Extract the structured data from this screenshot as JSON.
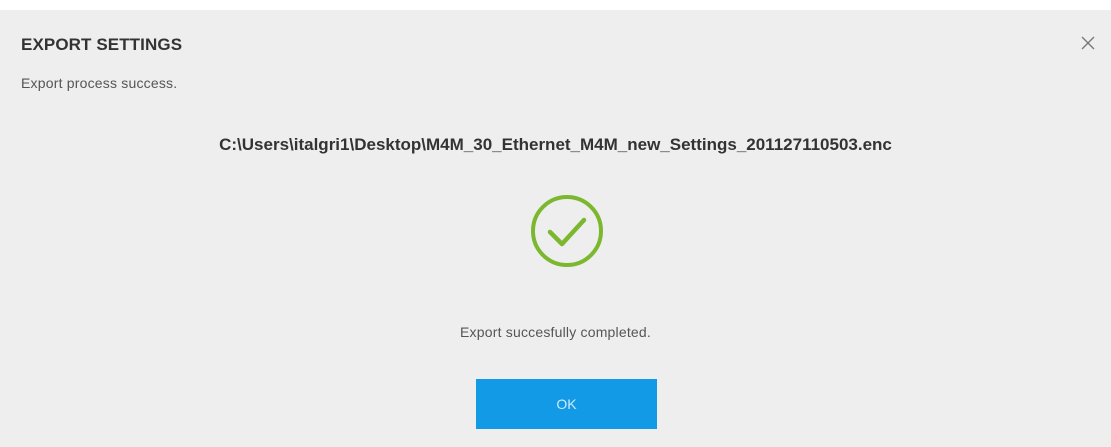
{
  "dialog": {
    "title": "EXPORT SETTINGS",
    "subtitle": "Export process success.",
    "file_path": "C:\\Users\\italgri1\\Desktop\\M4M_30_Ethernet_M4M_new_Settings_201127110503.enc",
    "message": "Export succesfully completed.",
    "ok_label": "OK",
    "close_icon": "close-icon",
    "status_icon": "check-circle-icon"
  },
  "colors": {
    "dialog_background": "#eeeeee",
    "accent": "#129ae6",
    "success": "#7cb82f",
    "title_text": "#333333",
    "body_text": "#555555"
  }
}
